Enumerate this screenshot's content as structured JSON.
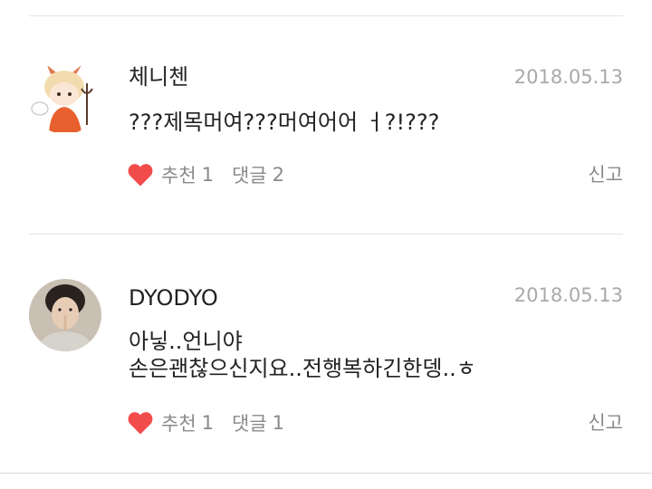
{
  "comments": [
    {
      "avatar": "cartoon-devil-avatar",
      "username": "체니첸",
      "date": "2018.05.13",
      "text": "???제목머여???머여어어 ㅓ?!???",
      "like_label": "추천",
      "like_count": "1",
      "reply_label": "댓글",
      "reply_count": "2",
      "report_label": "신고"
    },
    {
      "avatar": "person-photo-avatar",
      "username": "DYODYO",
      "date": "2018.05.13",
      "text": "아닣..언니야\n손은괜찮으신지요..전행복하긴한뎅..ㅎ",
      "like_label": "추천",
      "like_count": "1",
      "reply_label": "댓글",
      "reply_count": "1",
      "report_label": "신고"
    }
  ],
  "colors": {
    "heart": "#f24b4b",
    "meta_text": "#8a8a8a",
    "date_text": "#a9a9a9",
    "divider": "#e3e3e3"
  }
}
